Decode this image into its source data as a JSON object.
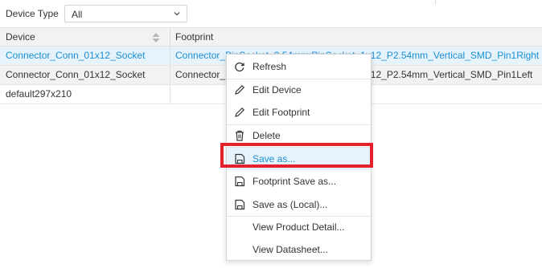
{
  "filter": {
    "label": "Device Type",
    "selected": "All"
  },
  "table": {
    "columns": [
      "Device",
      "Footprint"
    ],
    "rows": [
      {
        "device": "Connector_Conn_01x12_Socket",
        "footprint": "Connector_PinSocket_2.54mm:PinSocket_1x12_P2.54mm_Vertical_SMD_Pin1Right",
        "selected": true
      },
      {
        "device": "Connector_Conn_01x12_Socket",
        "footprint": "Connector_PinSocket_2.54mm:PinSocket_1x12_P2.54mm_Vertical_SMD_Pin1Left",
        "selected": false
      },
      {
        "device": "default297x210",
        "footprint": "",
        "selected": false
      }
    ]
  },
  "context_menu": {
    "items": [
      {
        "label": "Refresh",
        "icon": "refresh-icon"
      },
      {
        "label": "Edit Device",
        "icon": "pencil-icon"
      },
      {
        "label": "Edit Footprint",
        "icon": "pencil-icon"
      },
      {
        "label": "Delete",
        "icon": "trash-icon"
      },
      {
        "label": "Save as...",
        "icon": "save-icon",
        "highlighted": true
      },
      {
        "label": "Footprint Save as...",
        "icon": "save-icon"
      },
      {
        "label": "Save as (Local)...",
        "icon": "save-icon"
      },
      {
        "label": "View Product Detail...",
        "icon": ""
      },
      {
        "label": "View Datasheet...",
        "icon": ""
      }
    ]
  },
  "colors": {
    "accent": "#1a8fd6",
    "highlight_box": "#e3202b",
    "selected_row": "#e6f3fb"
  }
}
